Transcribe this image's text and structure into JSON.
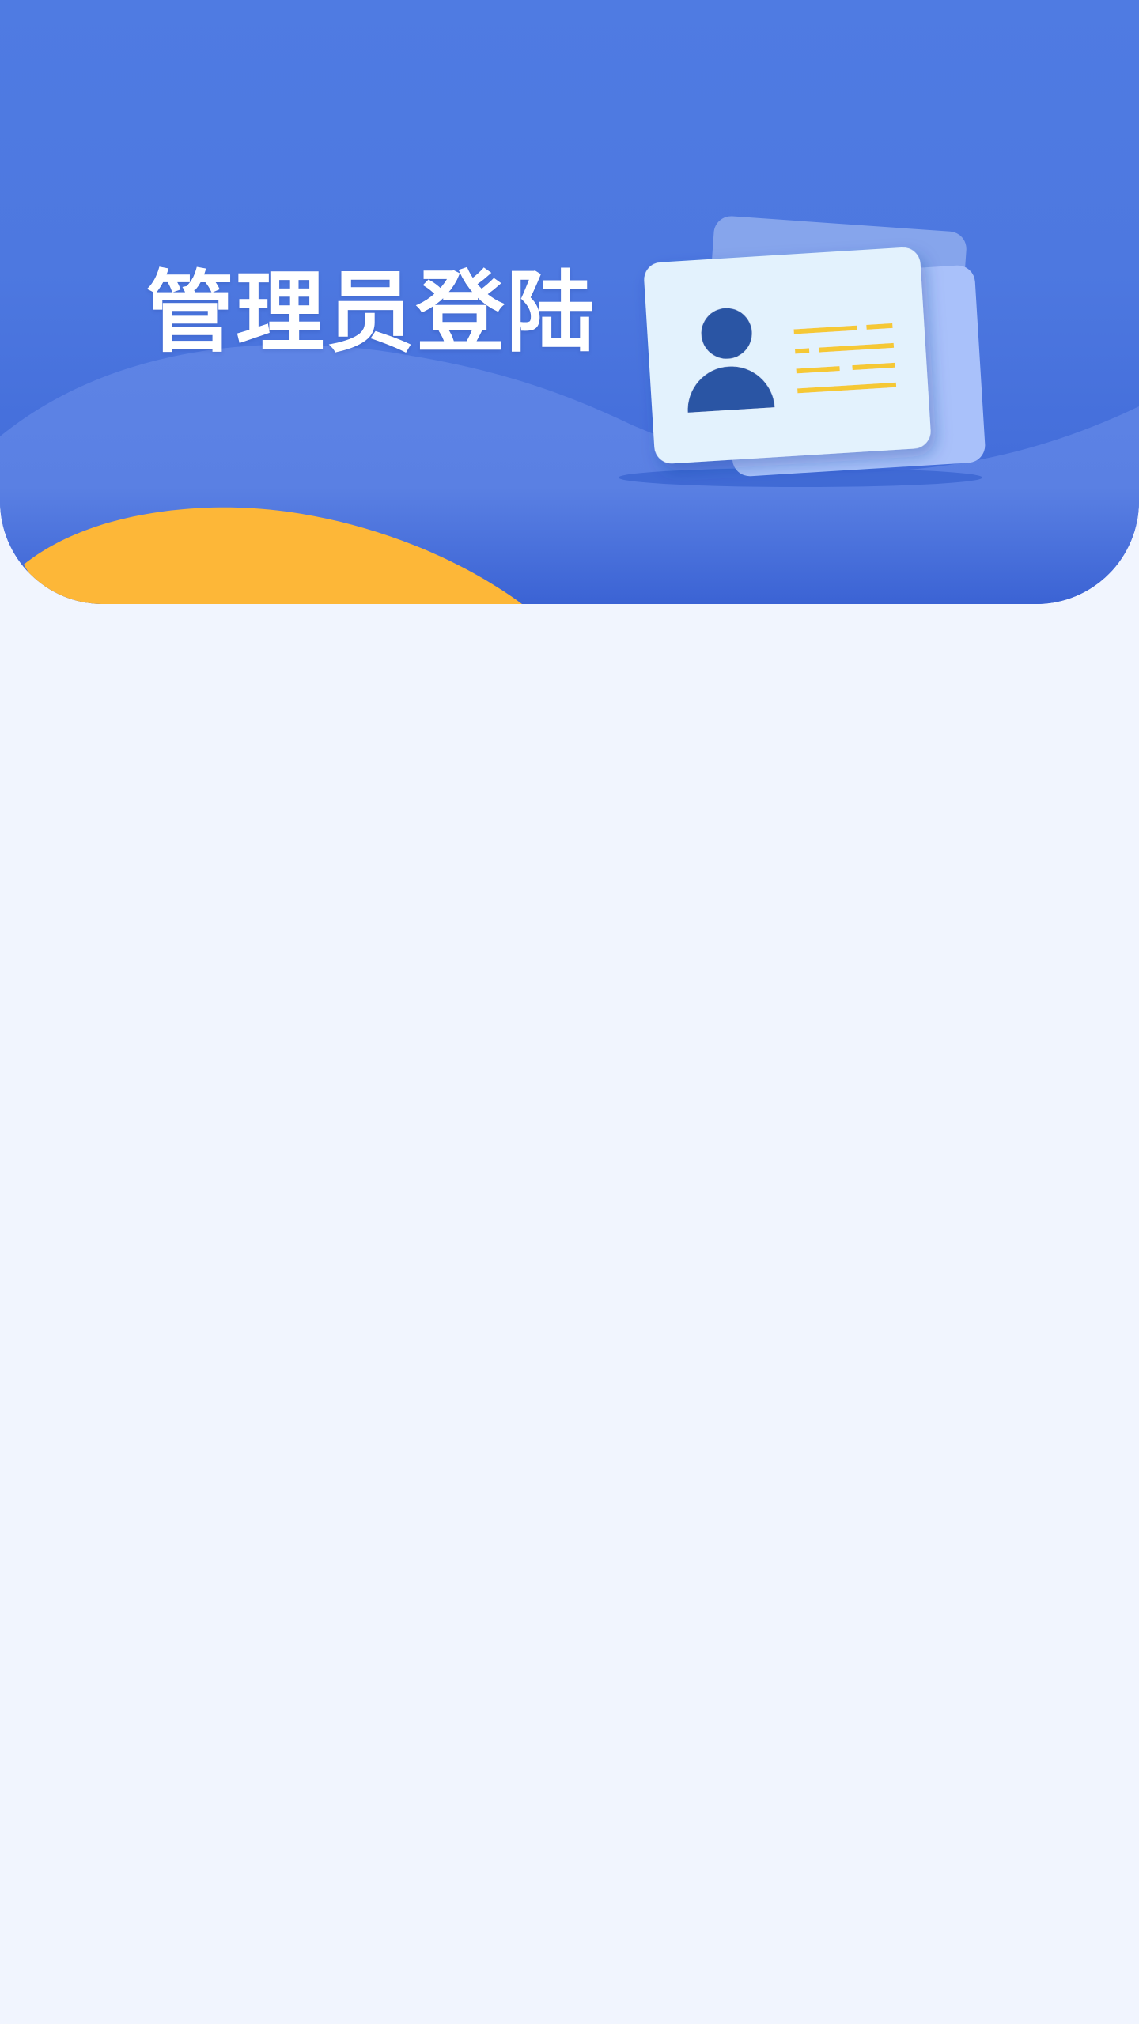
{
  "header": {
    "title": "管理员登陆"
  },
  "colors": {
    "hero_top": "#4f7be2",
    "hero_bottom": "#3d66d6",
    "wave": "#5d83e4",
    "accent_yellow": "#fdb738",
    "card_face": "#e3f2fd",
    "card_back": "#86a5ec",
    "card_back_light": "#a9c1fa",
    "avatar": "#2c54a4",
    "card_lines": "#f5c834",
    "page_background": "#f1f5fe"
  },
  "illustration": {
    "icon": "id-card-icon",
    "avatar_icon": "person-icon"
  }
}
